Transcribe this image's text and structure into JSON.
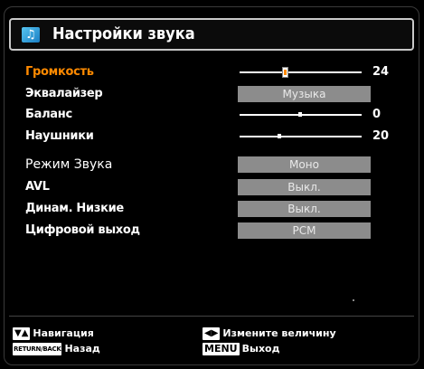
{
  "title": "Настройки звука",
  "settings": [
    {
      "label": "Громкость",
      "type": "slider",
      "value": "24",
      "level": 0.35
    },
    {
      "label": "Эквалайзер",
      "type": "select",
      "value": "Музыка"
    },
    {
      "label": "Баланс",
      "type": "slider",
      "value": "0",
      "level": 0.5
    },
    {
      "label": "Наушники",
      "type": "slider",
      "value": "20",
      "level": 0.33
    },
    {
      "label": "Режим Звука",
      "type": "select",
      "value": "Моно"
    },
    {
      "label": "AVL",
      "type": "select",
      "value": "Выкл."
    },
    {
      "label": "Динам. Низкие",
      "type": "select",
      "value": "Выкл."
    },
    {
      "label": "Цифровой выход",
      "type": "select",
      "value": "PCM"
    }
  ],
  "footer": {
    "nav_label": "Навигация",
    "nav_keys": "▼▲",
    "back_key": "RETURN/BACK",
    "back_label": "Назад",
    "change_keys": "◀▶",
    "change_label": "Измените величину",
    "menu_key": "MENU",
    "exit_label": "Выход"
  },
  "colors": {
    "selected_label": "#ff8a00",
    "pill_bg": "#8c8c8c",
    "slider_fill": "#ff8a00"
  }
}
